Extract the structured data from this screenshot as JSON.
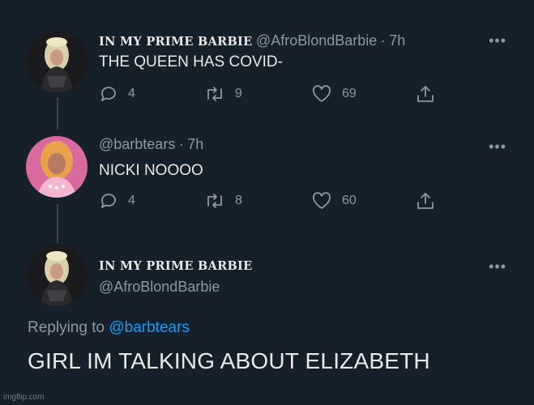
{
  "tweets": [
    {
      "display_name": "IN MY PRIME BARBIE",
      "handle": "@AfroBlondBarbie",
      "separator": "·",
      "time": "7h",
      "text": "THE QUEEN HAS COVID-",
      "replies": "4",
      "retweets": "9",
      "likes": "69",
      "avatar": "avatar-barbie-dark"
    },
    {
      "handle": "@barbtears",
      "separator": "·",
      "time": "7h",
      "text": "NICKI NOOOO",
      "replies": "4",
      "retweets": "8",
      "likes": "60",
      "avatar": "avatar-barbtears-pink"
    }
  ],
  "main_tweet": {
    "display_name": "IN MY PRIME BARBIE",
    "handle": "@AfroBlondBarbie",
    "replying_prefix": "Replying to",
    "replying_mention": "@barbtears",
    "text": "GIRL IM TALKING ABOUT ELIZABETH"
  },
  "more_glyph": "•••",
  "watermark": "imgflip.com",
  "colors": {
    "background": "#15202b",
    "text": "#e7e9ea",
    "secondary": "#8b98a5",
    "link": "#1d9bf0",
    "thread_line": "#38444d"
  },
  "icons": [
    "reply-icon",
    "retweet-icon",
    "like-icon",
    "share-icon",
    "more-icon"
  ]
}
